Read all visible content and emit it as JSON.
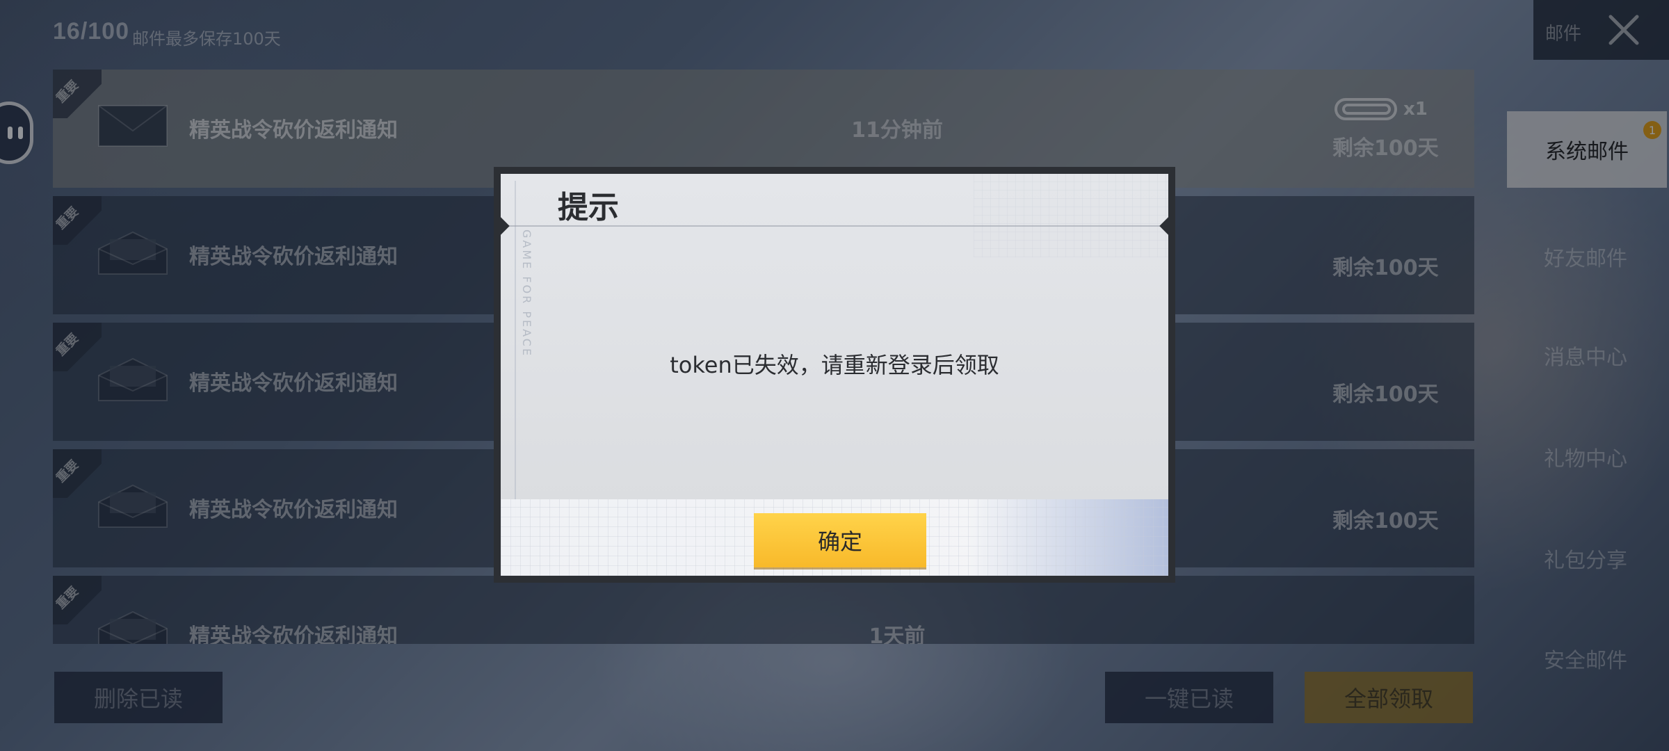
{
  "header": {
    "count": "16/100",
    "note": "邮件最多保存100天",
    "panel_title": "邮件"
  },
  "mails": [
    {
      "tag": "重要",
      "title": "精英战令砍价返利通知",
      "time": "11分钟前",
      "remain": "剩余100天",
      "attachment_count": "x1",
      "read": false
    },
    {
      "tag": "重要",
      "title": "精英战令砍价返利通知",
      "time": "",
      "remain": "剩余100天",
      "read": true
    },
    {
      "tag": "重要",
      "title": "精英战令砍价返利通知",
      "time": "",
      "remain": "剩余100天",
      "read": true
    },
    {
      "tag": "重要",
      "title": "精英战令砍价返利通知",
      "time": "",
      "remain": "剩余100天",
      "read": true
    },
    {
      "tag": "重要",
      "title": "精英战令砍价返利通知",
      "time": "1天前",
      "remain": "",
      "read": true
    }
  ],
  "side_tabs": [
    {
      "label": "系统邮件",
      "active": true,
      "badge": "1"
    },
    {
      "label": "好友邮件",
      "active": false
    },
    {
      "label": "消息中心",
      "active": false
    },
    {
      "label": "礼物中心",
      "active": false
    },
    {
      "label": "礼包分享",
      "active": false
    },
    {
      "label": "安全邮件",
      "active": false
    }
  ],
  "buttons": {
    "delete_read": "删除已读",
    "read_all": "一键已读",
    "claim_all": "全部领取"
  },
  "dialog": {
    "title": "提示",
    "message": "token已失效，请重新登录后领取",
    "confirm": "确定",
    "stamp": "GAME FOR PEACE"
  },
  "colors": {
    "confirm_button": "#f8b92a",
    "badge": "#e8a012",
    "dialog_bg": "#e4e6ea"
  }
}
